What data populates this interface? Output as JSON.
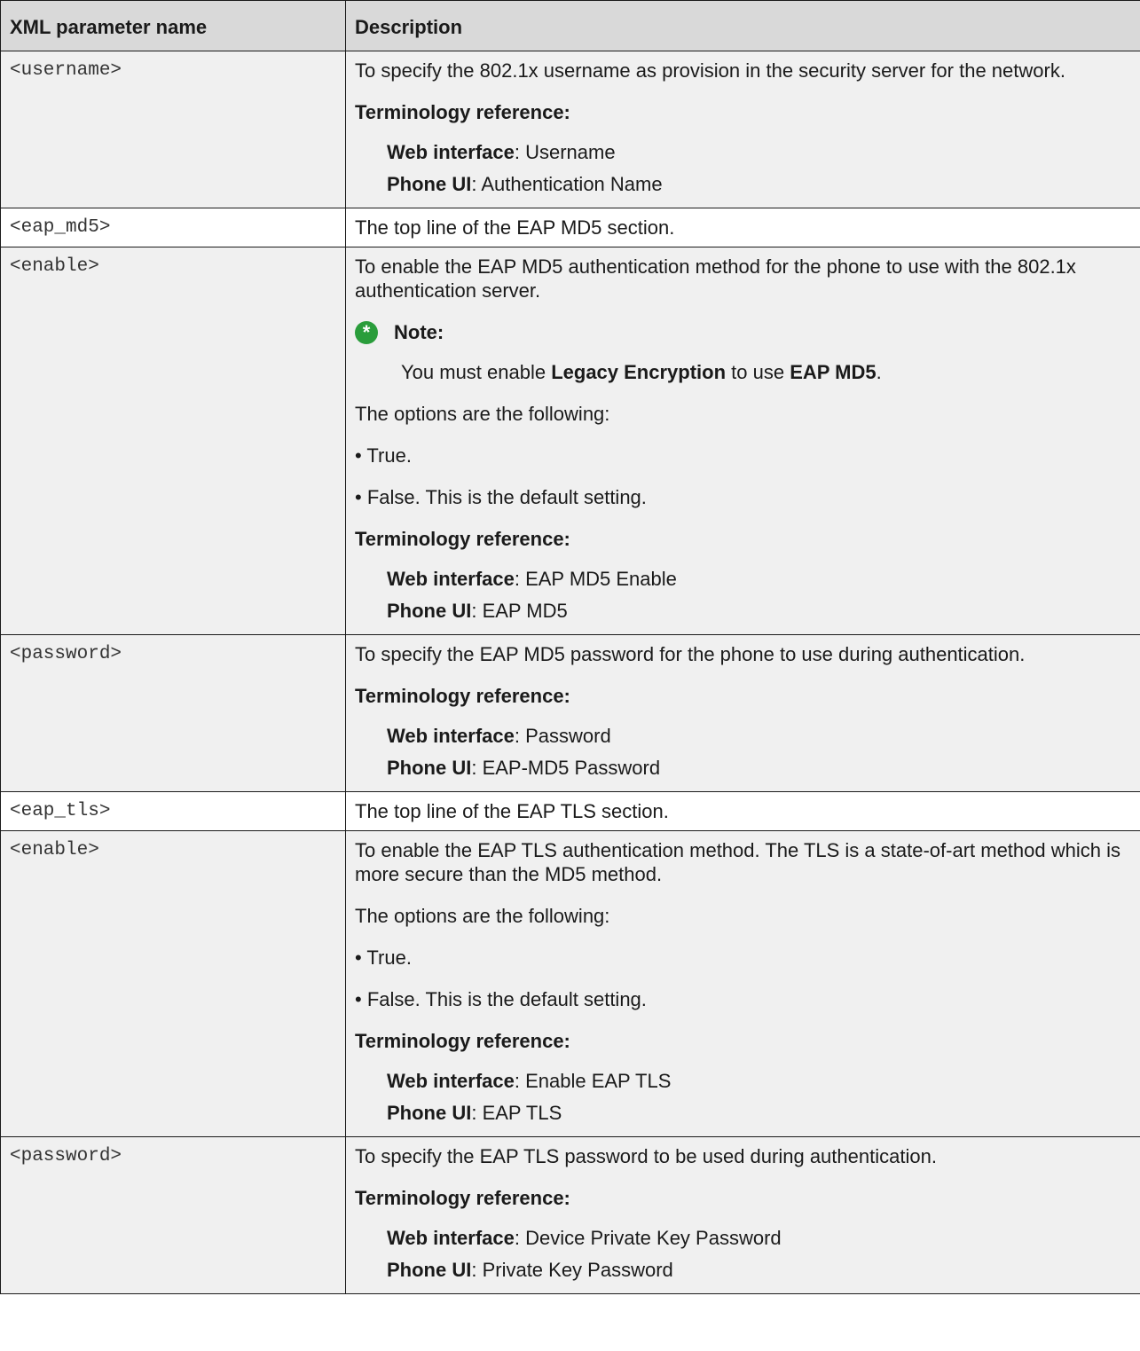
{
  "header": {
    "col1": "XML parameter name",
    "col2": "Description"
  },
  "rows": [
    {
      "param": "<username>",
      "desc": "To specify the 802.1x username as provision in the security server for the network.",
      "term_head": "Terminology reference:",
      "web_label": "Web interface",
      "web_value": ": Username",
      "phone_label": "Phone UI",
      "phone_value": ": Authentication Name"
    },
    {
      "param": "<eap_md5>",
      "desc": "The top line of the EAP MD5 section."
    },
    {
      "param": "<enable>",
      "desc": "To enable the EAP MD5 authentication method for the phone to use with the 802.1x authentication server.",
      "note_label": "Note:",
      "note_pre": "You must enable ",
      "note_b1": "Legacy Encryption",
      "note_mid": " to use ",
      "note_b2": "EAP MD5",
      "note_end": ".",
      "options": "The options are the following:",
      "opt1": "• True.",
      "opt2": "• False. This is the default setting.",
      "term_head": "Terminology reference:",
      "web_label": "Web interface",
      "web_value": ": EAP MD5 Enable",
      "phone_label": "Phone UI",
      "phone_value": ": EAP MD5"
    },
    {
      "param": "<password>",
      "desc": "To specify the EAP MD5 password for the phone to use during authentication.",
      "term_head": "Terminology reference:",
      "web_label": "Web interface",
      "web_value": ": Password",
      "phone_label": "Phone UI",
      "phone_value": ": EAP-MD5 Password"
    },
    {
      "param": "<eap_tls>",
      "desc": "The top line of the EAP TLS section."
    },
    {
      "param": "<enable>",
      "desc": "To enable the EAP TLS authentication method. The TLS is a state-of-art method which is more secure than the MD5 method.",
      "options": "The options are the following:",
      "opt1": "• True.",
      "opt2": "• False. This is the default setting.",
      "term_head": "Terminology reference:",
      "web_label": "Web interface",
      "web_value": ": Enable EAP TLS",
      "phone_label": "Phone UI",
      "phone_value": ": EAP TLS"
    },
    {
      "param": "<password>",
      "desc": "To specify the EAP TLS password to be used during authentication.",
      "term_head": "Terminology reference:",
      "web_label": "Web interface",
      "web_value": ": Device Private Key Password",
      "phone_label": "Phone UI",
      "phone_value": ": Private Key Password"
    }
  ]
}
